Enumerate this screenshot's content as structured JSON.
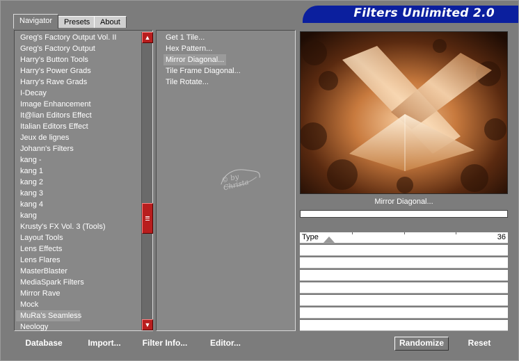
{
  "app": {
    "title": "Filters Unlimited 2.0"
  },
  "tabs": [
    {
      "label": "Navigator",
      "active": true
    },
    {
      "label": "Presets",
      "active": false
    },
    {
      "label": "About",
      "active": false
    }
  ],
  "categories": [
    "Greg's Factory Output Vol. II",
    "Greg's Factory Output",
    "Harry's Button Tools",
    "Harry's Power Grads",
    "Harry's Rave Grads",
    "I-Decay",
    "Image Enhancement",
    "It@lian Editors Effect",
    "Italian Editors Effect",
    "Jeux de lignes",
    "Johann's Filters",
    "kang -",
    "kang 1",
    "kang 2",
    "kang 3",
    "kang 4",
    "kang",
    "Krusty's FX Vol. 3 (Tools)",
    "Layout Tools",
    "Lens Effects",
    "Lens Flares",
    "MasterBlaster",
    "MediaSpark Filters",
    "Mirror Rave",
    "Mock",
    "MuRa's Seamless",
    "Neology"
  ],
  "selected_category_index": 25,
  "filters": [
    "Get 1 Tile...",
    "Hex Pattern...",
    "Mirror Diagonal...",
    "Tile Frame Diagonal...",
    "Tile Rotate..."
  ],
  "selected_filter_index": 2,
  "watermark": {
    "text": "© by Christa"
  },
  "preview": {
    "caption": "Mirror Diagonal..."
  },
  "parameters": [
    {
      "label": "Type",
      "value": "36"
    }
  ],
  "buttons": {
    "database": "Database",
    "import": "Import...",
    "filter_info": "Filter Info...",
    "editor": "Editor...",
    "randomize": "Randomize",
    "reset": "Reset"
  },
  "colors": {
    "banner": "#0b1f9e",
    "scrollbar": "#b81e1e",
    "window": "#7c7c7c"
  }
}
